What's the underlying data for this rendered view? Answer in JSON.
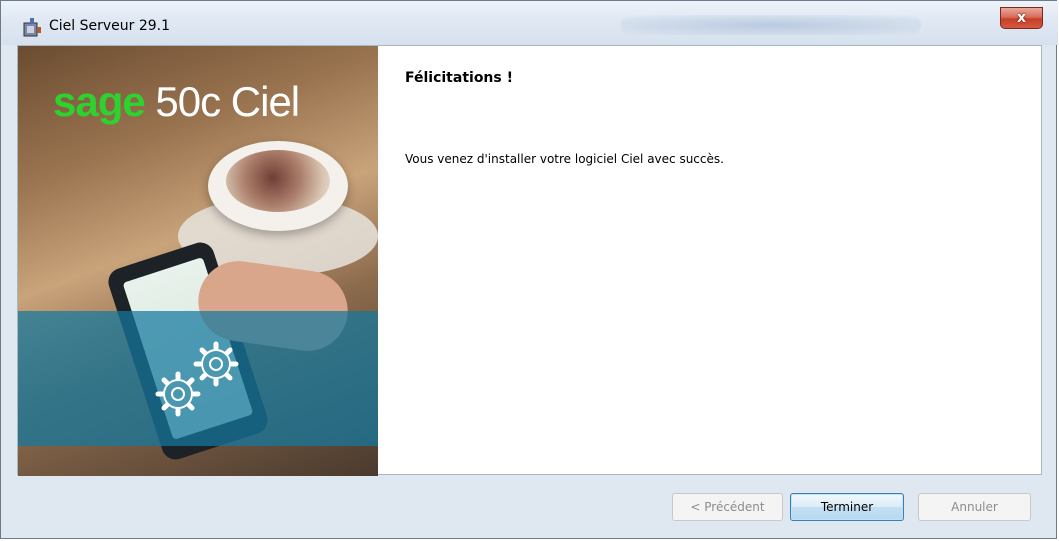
{
  "window": {
    "title": "Ciel Serveur 29.1",
    "close_symbol": "x"
  },
  "hero": {
    "logo_brand": "sage",
    "logo_rest": " 50c Ciel",
    "colors": {
      "brand": "#2ed12e",
      "band": "#1478a0"
    }
  },
  "content": {
    "heading": "Félicitations !",
    "message": "Vous venez d'installer votre logiciel Ciel avec succès."
  },
  "buttons": {
    "previous": "< Précédent",
    "finish": "Terminer",
    "cancel": "Annuler"
  },
  "icons": [
    "installer-icon",
    "close-icon",
    "gears-icon"
  ]
}
